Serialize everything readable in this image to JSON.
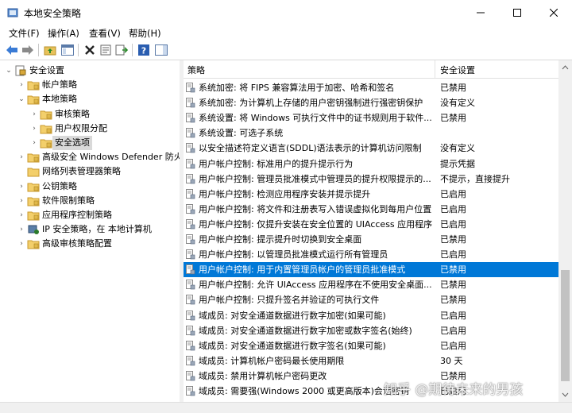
{
  "window": {
    "title": "本地安全策略"
  },
  "menu": [
    "文件(F)",
    "操作(A)",
    "查看(V)",
    "帮助(H)"
  ],
  "tree": [
    {
      "label": "安全设置",
      "depth": 0,
      "expanded": true,
      "icon": "security-settings-icon"
    },
    {
      "label": "帐户策略",
      "depth": 1,
      "expanded": false,
      "icon": "folder-icon"
    },
    {
      "label": "本地策略",
      "depth": 1,
      "expanded": true,
      "icon": "folder-icon"
    },
    {
      "label": "审核策略",
      "depth": 2,
      "expanded": false,
      "icon": "folder-icon"
    },
    {
      "label": "用户权限分配",
      "depth": 2,
      "expanded": false,
      "icon": "folder-icon"
    },
    {
      "label": "安全选项",
      "depth": 2,
      "expanded": false,
      "icon": "folder-icon",
      "selected": true
    },
    {
      "label": "高级安全 Windows Defender 防火墙",
      "depth": 1,
      "expanded": false,
      "icon": "folder-icon"
    },
    {
      "label": "网络列表管理器策略",
      "depth": 1,
      "expanded": null,
      "icon": "folder-icon"
    },
    {
      "label": "公钥策略",
      "depth": 1,
      "expanded": false,
      "icon": "folder-icon"
    },
    {
      "label": "软件限制策略",
      "depth": 1,
      "expanded": false,
      "icon": "folder-icon"
    },
    {
      "label": "应用程序控制策略",
      "depth": 1,
      "expanded": false,
      "icon": "folder-icon"
    },
    {
      "label": "IP 安全策略，在 本地计算机",
      "depth": 1,
      "expanded": false,
      "icon": "ip-security-icon"
    },
    {
      "label": "高级审核策略配置",
      "depth": 1,
      "expanded": false,
      "icon": "folder-icon"
    }
  ],
  "columns": {
    "policy": "策略",
    "setting": "安全设置"
  },
  "policies": [
    {
      "name": "系统加密: 将 FIPS 兼容算法用于加密、哈希和签名",
      "value": "已禁用"
    },
    {
      "name": "系统加密: 为计算机上存储的用户密钥强制进行强密钥保护",
      "value": "没有定义"
    },
    {
      "name": "系统设置: 将 Windows 可执行文件中的证书规则用于软件...",
      "value": "已禁用"
    },
    {
      "name": "系统设置: 可选子系统",
      "value": ""
    },
    {
      "name": "以安全描述符定义语言(SDDL)语法表示的计算机访问限制",
      "value": "没有定义"
    },
    {
      "name": "用户帐户控制: 标准用户的提升提示行为",
      "value": "提示凭据"
    },
    {
      "name": "用户帐户控制: 管理员批准模式中管理员的提升权限提示的...",
      "value": "不提示，直接提升"
    },
    {
      "name": "用户帐户控制: 检测应用程序安装并提示提升",
      "value": "已启用"
    },
    {
      "name": "用户帐户控制: 将文件和注册表写入错误虚拟化到每用户位置",
      "value": "已启用"
    },
    {
      "name": "用户帐户控制: 仅提升安装在安全位置的 UIAccess 应用程序",
      "value": "已启用"
    },
    {
      "name": "用户帐户控制: 提示提升时切换到安全桌面",
      "value": "已禁用"
    },
    {
      "name": "用户帐户控制: 以管理员批准模式运行所有管理员",
      "value": "已启用"
    },
    {
      "name": "用户帐户控制: 用于内置管理员帐户的管理员批准模式",
      "value": "已禁用",
      "selected": true
    },
    {
      "name": "用户帐户控制: 允许 UIAccess 应用程序在不使用安全桌面...",
      "value": "已禁用"
    },
    {
      "name": "用户帐户控制: 只提升签名并验证的可执行文件",
      "value": "已禁用"
    },
    {
      "name": "域成员: 对安全通道数据进行数字加密(如果可能)",
      "value": "已启用"
    },
    {
      "name": "域成员: 对安全通道数据进行数字加密或数字签名(始终)",
      "value": "已启用"
    },
    {
      "name": "域成员: 对安全通道数据进行数字签名(如果可能)",
      "value": "已启用"
    },
    {
      "name": "域成员: 计算机帐户密码最长使用期限",
      "value": "30 天"
    },
    {
      "name": "域成员: 禁用计算机帐户密码更改",
      "value": "已禁用"
    },
    {
      "name": "域成员: 需要强(Windows 2000 或更高版本)会话密钥",
      "value": "已启用"
    }
  ],
  "watermark": "知乎 @期待未来的男孩",
  "colors": {
    "selection": "#0078d7",
    "tree_selection": "#d9d9d9"
  }
}
